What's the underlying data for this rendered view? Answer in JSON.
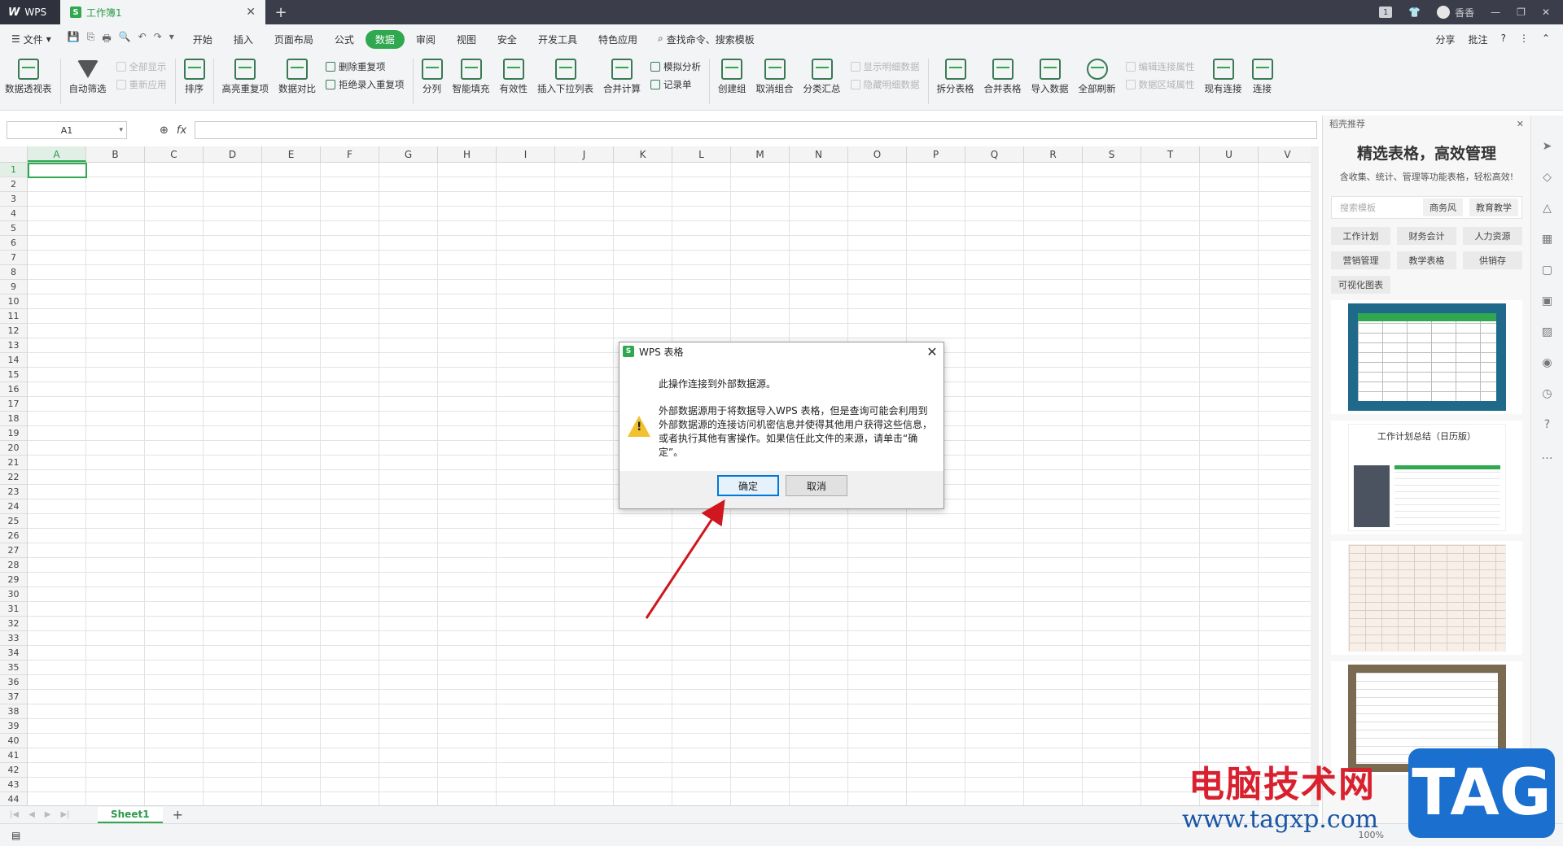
{
  "titlebar": {
    "app_label": "WPS",
    "doc_tab": "工作簿1",
    "badge": "1",
    "user": "香香"
  },
  "menubar": {
    "file": "文件",
    "items": [
      "开始",
      "插入",
      "页面布局",
      "公式",
      "数据",
      "审阅",
      "视图",
      "安全",
      "开发工具",
      "特色应用"
    ],
    "active": "数据",
    "search": "查找命令、搜索模板",
    "share": "分享",
    "annotate": "批注"
  },
  "ribbon": {
    "pivot": "数据透视表",
    "autofilter": "自动筛选",
    "show_all": "全部显示",
    "reapply": "重新应用",
    "sort": "排序",
    "highlight_dup": "高亮重复项",
    "compare": "数据对比",
    "remove_dup": "删除重复项",
    "reject_dup": "拒绝录入重复项",
    "split": "分列",
    "smart_fill": "智能填充",
    "validity": "有效性",
    "dropdown": "插入下拉列表",
    "consolidate": "合并计算",
    "simulate": "模拟分析",
    "record": "记录单",
    "group": "创建组",
    "ungroup": "取消组合",
    "subtotal": "分类汇总",
    "show_detail": "显示明细数据",
    "hide_detail": "隐藏明细数据",
    "split_table": "拆分表格",
    "merge_table": "合并表格",
    "import": "导入数据",
    "refresh_all": "全部刷新",
    "edit_conn": "编辑连接属性",
    "range_prop": "数据区域属性",
    "existing_conn": "现有连接",
    "connect": "连接"
  },
  "formula": {
    "namebox": "A1",
    "fx": "fx"
  },
  "sheet": {
    "columns": [
      "A",
      "B",
      "C",
      "D",
      "E",
      "F",
      "G",
      "H",
      "I",
      "J",
      "K",
      "L",
      "M",
      "N",
      "O",
      "P",
      "Q",
      "R",
      "S",
      "T",
      "U",
      "V"
    ],
    "rows": [
      "1",
      "2",
      "3",
      "4",
      "5",
      "6",
      "7",
      "8",
      "9",
      "10",
      "11",
      "12",
      "13",
      "14",
      "15",
      "16",
      "17",
      "18",
      "19",
      "20",
      "21",
      "22",
      "23",
      "24",
      "25",
      "26",
      "27",
      "28",
      "29",
      "30",
      "31",
      "32",
      "33",
      "34",
      "35",
      "36",
      "37",
      "38",
      "39",
      "40",
      "41",
      "42",
      "43",
      "44"
    ],
    "tab": "Sheet1",
    "zoom": "100%"
  },
  "panel": {
    "header": "稻壳推荐",
    "title": "精选表格，高效管理",
    "subtitle": "含收集、统计、管理等功能表格，轻松高效!",
    "search_placeholder": "搜索模板",
    "chip_business": "商务风",
    "chip_education": "教育教学",
    "chips": [
      "工作计划",
      "财务会计",
      "人力资源",
      "营销管理",
      "教学表格",
      "供销存"
    ],
    "viz": "可视化图表",
    "card2_caption": "工作计划总结（日历版）"
  },
  "dialog": {
    "title": "WPS 表格",
    "line1": "此操作连接到外部数据源。",
    "message": "外部数据源用于将数据导入WPS 表格，但是查询可能会利用到外部数据源的连接访问机密信息并使得其他用户获得这些信息，或者执行其他有害操作。如果信任此文件的来源，请单击“确定”。",
    "ok": "确定",
    "cancel": "取消"
  },
  "watermark": {
    "text": "电脑技术网",
    "url": "www.tagxp.com",
    "tag": "TAG"
  },
  "colors": {
    "accent": "#2fa84f",
    "arrow": "#d0161f"
  }
}
